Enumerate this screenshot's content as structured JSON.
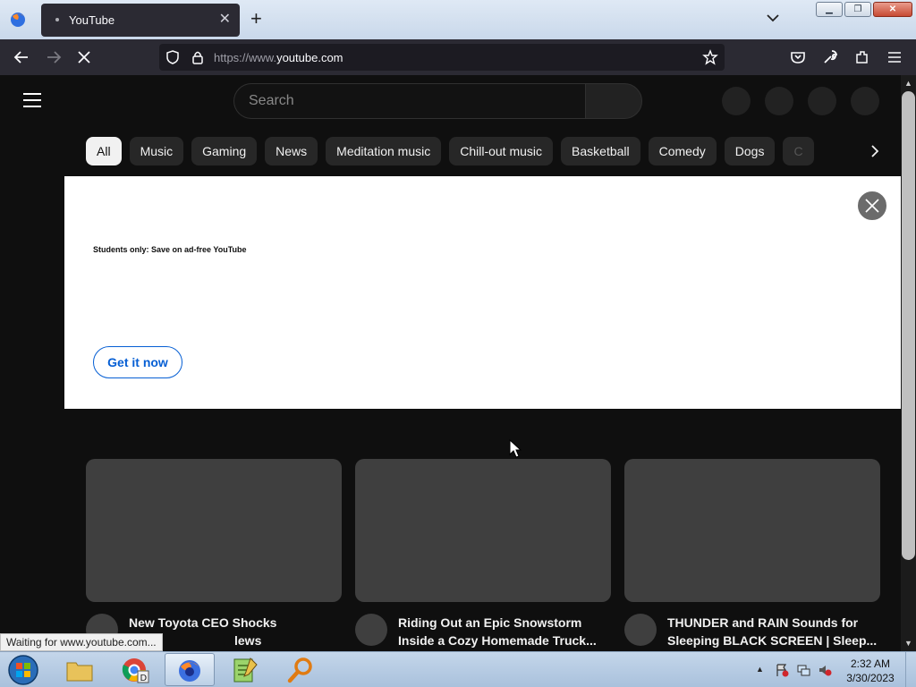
{
  "browser": {
    "tab_title": "YouTube",
    "url_prefix": "https://www.",
    "url_domain": "youtube.com",
    "status_text": "Waiting for www.youtube.com..."
  },
  "youtube": {
    "search_placeholder": "Search",
    "chips": [
      "All",
      "Music",
      "Gaming",
      "News",
      "Meditation music",
      "Chill-out music",
      "Basketball",
      "Comedy",
      "Dogs",
      "C"
    ],
    "active_chip": "All",
    "banner": {
      "headline": "Students only: Save on ad-free YouTube",
      "cta_label": "Get it now"
    },
    "videos": [
      {
        "title": "New Toyota CEO Shocks",
        "title_line2_visible": "lews"
      },
      {
        "title": "Riding Out an Epic Snowstorm Inside a Cozy Homemade Truck..."
      },
      {
        "title": "THUNDER and RAIN Sounds for Sleeping BLACK SCREEN | Sleep..."
      }
    ]
  },
  "taskbar": {
    "time": "2:32 AM",
    "date": "3/30/2023"
  },
  "colors": {
    "yt_background": "#0f0f0f",
    "chip_bg": "#272727",
    "accent_blue": "#065fd4",
    "browser_chrome": "#2b2a33"
  }
}
